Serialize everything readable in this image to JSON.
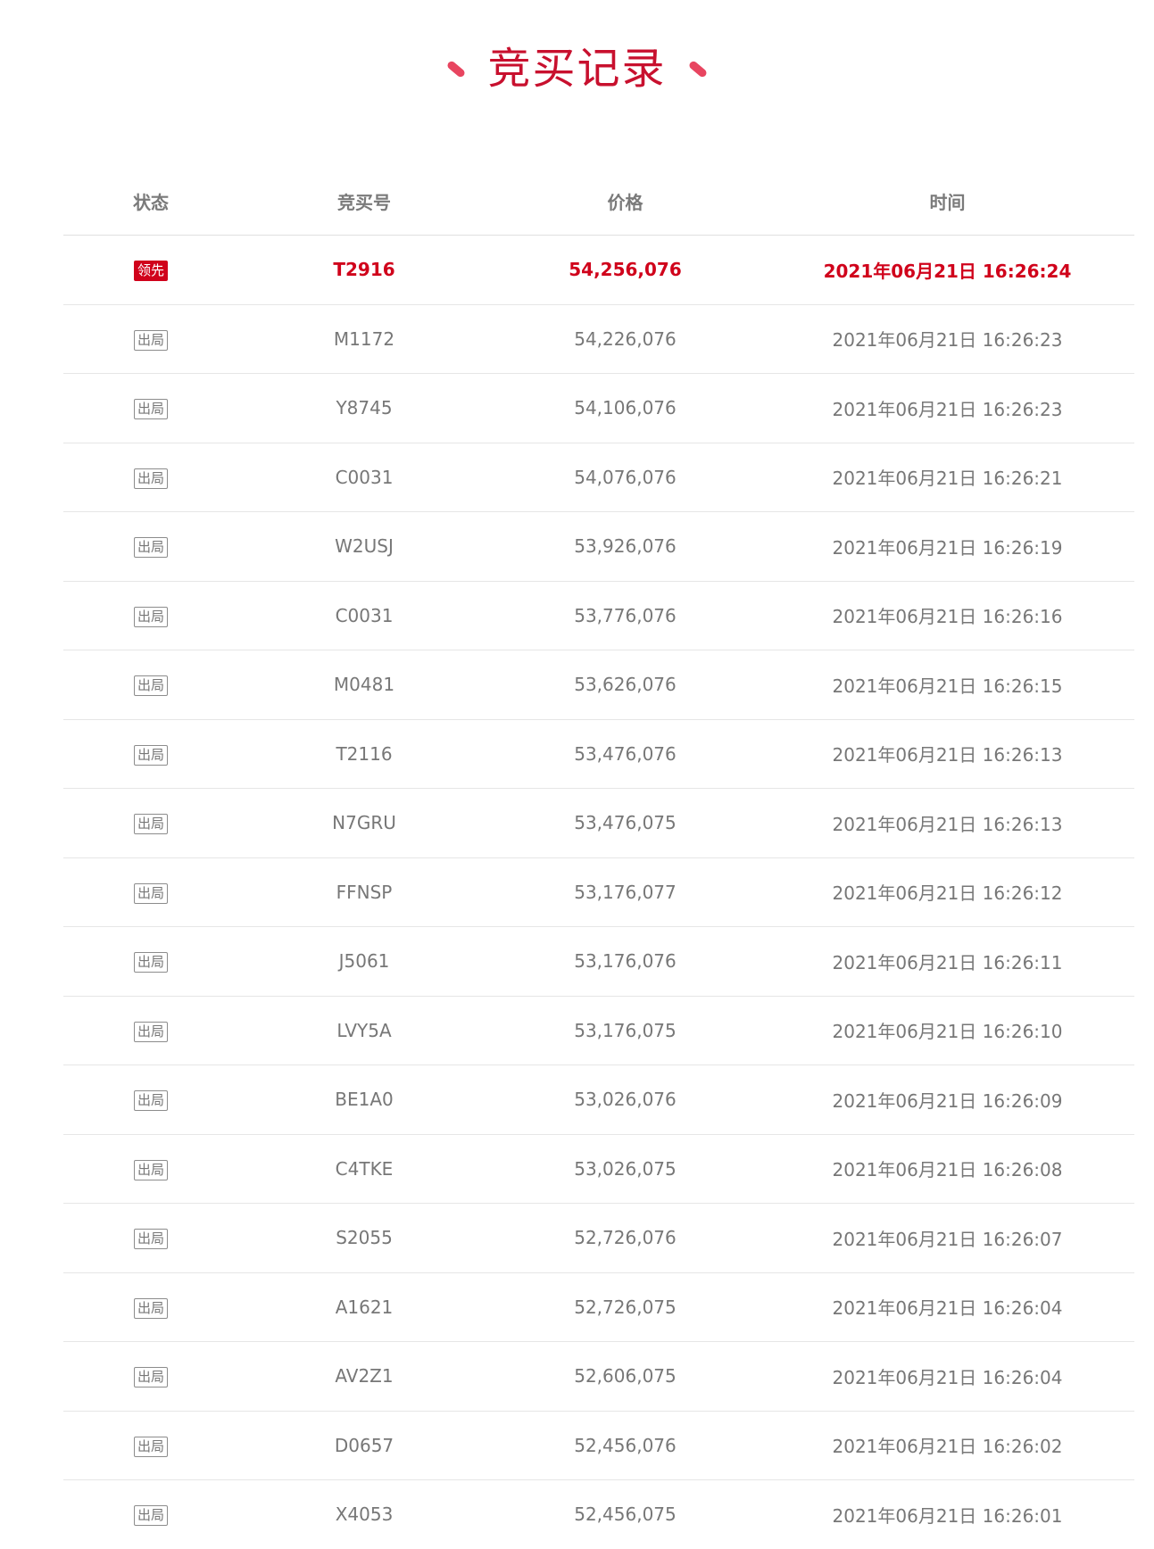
{
  "title": "竞买记录",
  "colors": {
    "accent": "#c8102e",
    "leader": "#d0021b",
    "text": "#777777"
  },
  "table": {
    "headers": [
      "状态",
      "竞买号",
      "价格",
      "时间"
    ],
    "rows": [
      {
        "status": "领先",
        "id": "T2916",
        "price": "54,256,076",
        "time": "2021年06月21日 16:26:24",
        "leader": true
      },
      {
        "status": "出局",
        "id": "M1172",
        "price": "54,226,076",
        "time": "2021年06月21日 16:26:23"
      },
      {
        "status": "出局",
        "id": "Y8745",
        "price": "54,106,076",
        "time": "2021年06月21日 16:26:23"
      },
      {
        "status": "出局",
        "id": "C0031",
        "price": "54,076,076",
        "time": "2021年06月21日 16:26:21"
      },
      {
        "status": "出局",
        "id": "W2USJ",
        "price": "53,926,076",
        "time": "2021年06月21日 16:26:19"
      },
      {
        "status": "出局",
        "id": "C0031",
        "price": "53,776,076",
        "time": "2021年06月21日 16:26:16"
      },
      {
        "status": "出局",
        "id": "M0481",
        "price": "53,626,076",
        "time": "2021年06月21日 16:26:15"
      },
      {
        "status": "出局",
        "id": "T2116",
        "price": "53,476,076",
        "time": "2021年06月21日 16:26:13"
      },
      {
        "status": "出局",
        "id": "N7GRU",
        "price": "53,476,075",
        "time": "2021年06月21日 16:26:13"
      },
      {
        "status": "出局",
        "id": "FFNSP",
        "price": "53,176,077",
        "time": "2021年06月21日 16:26:12"
      },
      {
        "status": "出局",
        "id": "J5061",
        "price": "53,176,076",
        "time": "2021年06月21日 16:26:11"
      },
      {
        "status": "出局",
        "id": "LVY5A",
        "price": "53,176,075",
        "time": "2021年06月21日 16:26:10"
      },
      {
        "status": "出局",
        "id": "BE1A0",
        "price": "53,026,076",
        "time": "2021年06月21日 16:26:09"
      },
      {
        "status": "出局",
        "id": "C4TKE",
        "price": "53,026,075",
        "time": "2021年06月21日 16:26:08"
      },
      {
        "status": "出局",
        "id": "S2055",
        "price": "52,726,076",
        "time": "2021年06月21日 16:26:07"
      },
      {
        "status": "出局",
        "id": "A1621",
        "price": "52,726,075",
        "time": "2021年06月21日 16:26:04"
      },
      {
        "status": "出局",
        "id": "AV2Z1",
        "price": "52,606,075",
        "time": "2021年06月21日 16:26:04"
      },
      {
        "status": "出局",
        "id": "D0657",
        "price": "52,456,076",
        "time": "2021年06月21日 16:26:02"
      },
      {
        "status": "出局",
        "id": "X4053",
        "price": "52,456,075",
        "time": "2021年06月21日 16:26:01"
      }
    ]
  }
}
